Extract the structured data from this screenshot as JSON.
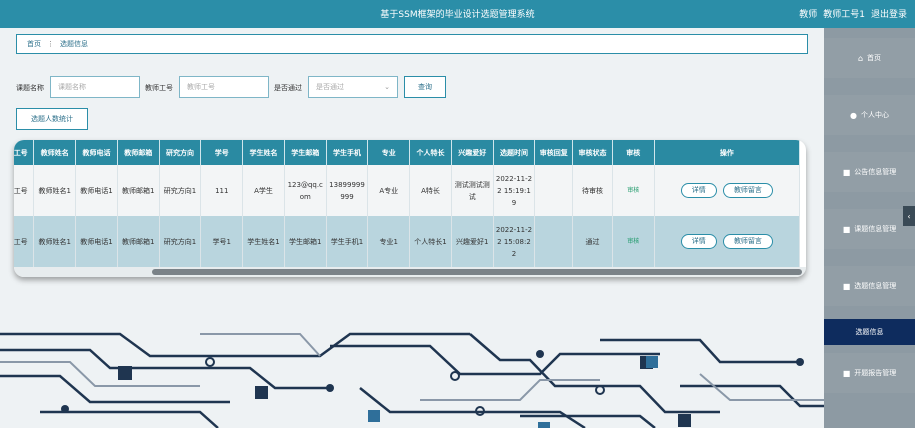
{
  "header": {
    "title": "基于SSM框架的毕业设计选题管理系统",
    "role": "教师",
    "user": "教师工号1",
    "logout": "退出登录"
  },
  "sidebar": {
    "items": [
      {
        "label": "首页",
        "icon": "home-icon",
        "glyph": "⌂"
      },
      {
        "label": "个人中心",
        "icon": "user-icon",
        "glyph": "●"
      },
      {
        "label": "公告信息管理",
        "icon": "bulletin-icon",
        "glyph": "■"
      },
      {
        "label": "课题信息管理",
        "icon": "topic-icon",
        "glyph": "■"
      },
      {
        "label": "选题信息管理",
        "icon": "selection-icon",
        "glyph": "■"
      },
      {
        "label": "选题信息",
        "icon": "",
        "glyph": ""
      },
      {
        "label": "开题报告管理",
        "icon": "report-icon",
        "glyph": "■"
      }
    ],
    "handle": "‹"
  },
  "breadcrumb": {
    "home": "首页",
    "sep": "⋮",
    "current": "选题信息"
  },
  "search": {
    "topic_label": "课题名称",
    "topic_placeholder": "课题名称",
    "teacher_label": "教师工号",
    "teacher_placeholder": "教师工号",
    "pass_label": "是否通过",
    "pass_placeholder": "是否通过",
    "query": "查询",
    "stats": "选题人数统计"
  },
  "table": {
    "columns": [
      "工号",
      "教师姓名",
      "教师电话",
      "教师邮箱",
      "研究方向",
      "学号",
      "学生姓名",
      "学生邮箱",
      "学生手机",
      "专业",
      "个人特长",
      "兴趣爱好",
      "选题时间",
      "审核回复",
      "审核状态",
      "审核",
      "操作"
    ],
    "rows": [
      [
        "工号",
        "教师姓名1",
        "教师电话1",
        "教师邮箱1",
        "研究方向1",
        "111",
        "A学生",
        "123@qq.com",
        "13899999999",
        "A专业",
        "A特长",
        "测试测试测试",
        "2022-11-22 15:19:19",
        "",
        "待审核",
        "审核"
      ],
      [
        "工号",
        "教师姓名1",
        "教师电话1",
        "教师邮箱1",
        "研究方向1",
        "学号1",
        "学生姓名1",
        "学生邮箱1",
        "学生手机1",
        "专业1",
        "个人特长1",
        "兴趣爱好1",
        "2022-11-22 15:08:22",
        "",
        "通过",
        "审核"
      ]
    ],
    "actions": {
      "detail": "详情",
      "message": "教师留言"
    }
  }
}
